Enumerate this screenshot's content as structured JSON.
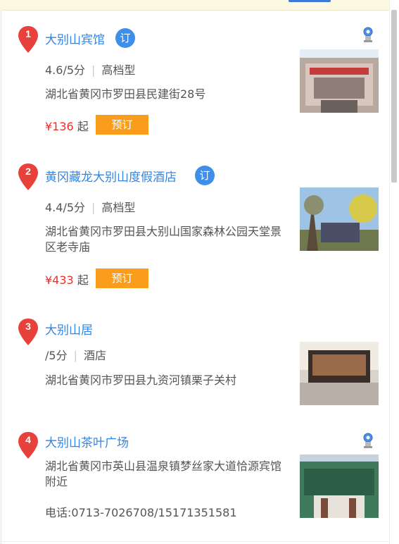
{
  "results": [
    {
      "number": "1",
      "name": "大别山宾馆",
      "badge": "订",
      "rating": "4.6/5分",
      "category": "高档型",
      "address": "湖北省黄冈市罗田县民建街28号",
      "price": "¥136",
      "price_suffix": "起",
      "book_label": "预订"
    },
    {
      "number": "2",
      "name": "黄冈藏龙大别山度假酒店",
      "badge": "订",
      "rating": "4.4/5分",
      "category": "高档型",
      "address": "湖北省黄冈市罗田县大别山国家森林公园天堂景区老寺庙",
      "price": "¥433",
      "price_suffix": "起",
      "book_label": "预订"
    },
    {
      "number": "3",
      "name": "大别山居",
      "rating": "/5分",
      "category": "酒店",
      "address": "湖北省黄冈市罗田县九资河镇栗子关村"
    },
    {
      "number": "4",
      "name": "大别山茶叶广场",
      "address": "湖北省黄冈市英山县温泉镇梦丝家大道恰源宾馆附近",
      "phone": "电话:0713-7026708/15171351581"
    }
  ],
  "colors": {
    "link": "#3385e6",
    "marker": "#e8413c",
    "price": "#e8312f",
    "book_button": "#fa9c1c",
    "badge": "#3f8fe8"
  },
  "icons": [
    "map-pin-icon",
    "panorama-icon",
    "reservation-badge-icon"
  ]
}
